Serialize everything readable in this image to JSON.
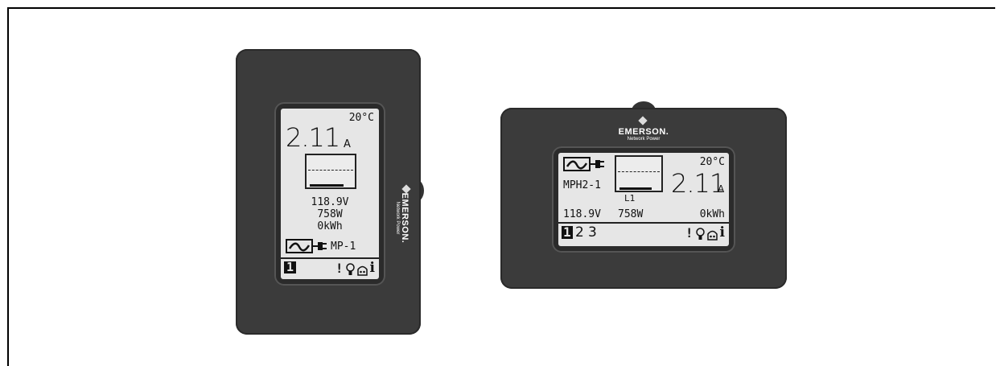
{
  "brand": {
    "name": "EMERSON.",
    "tagline": "Network Power"
  },
  "vertical_display": {
    "temperature": "20°C",
    "current": "2.11",
    "current_unit": "A",
    "voltage": "118.9V",
    "power": "758W",
    "energy": "0kWh",
    "outlet": "MP-1",
    "page_selected": "1",
    "status_icons": [
      "alarm-icon",
      "bulb-icon",
      "lock-icon",
      "info-icon"
    ]
  },
  "horizontal_display": {
    "temperature": "20°C",
    "current": "2.11",
    "current_unit": "A",
    "outlet": "MPH2-1",
    "line": "L1",
    "voltage": "118.9V",
    "power": "758W",
    "energy": "0kWh",
    "pages": [
      "1",
      "2",
      "3"
    ],
    "page_selected": "1",
    "status_icons": [
      "alarm-icon",
      "bulb-icon",
      "lock-icon",
      "info-icon"
    ]
  }
}
